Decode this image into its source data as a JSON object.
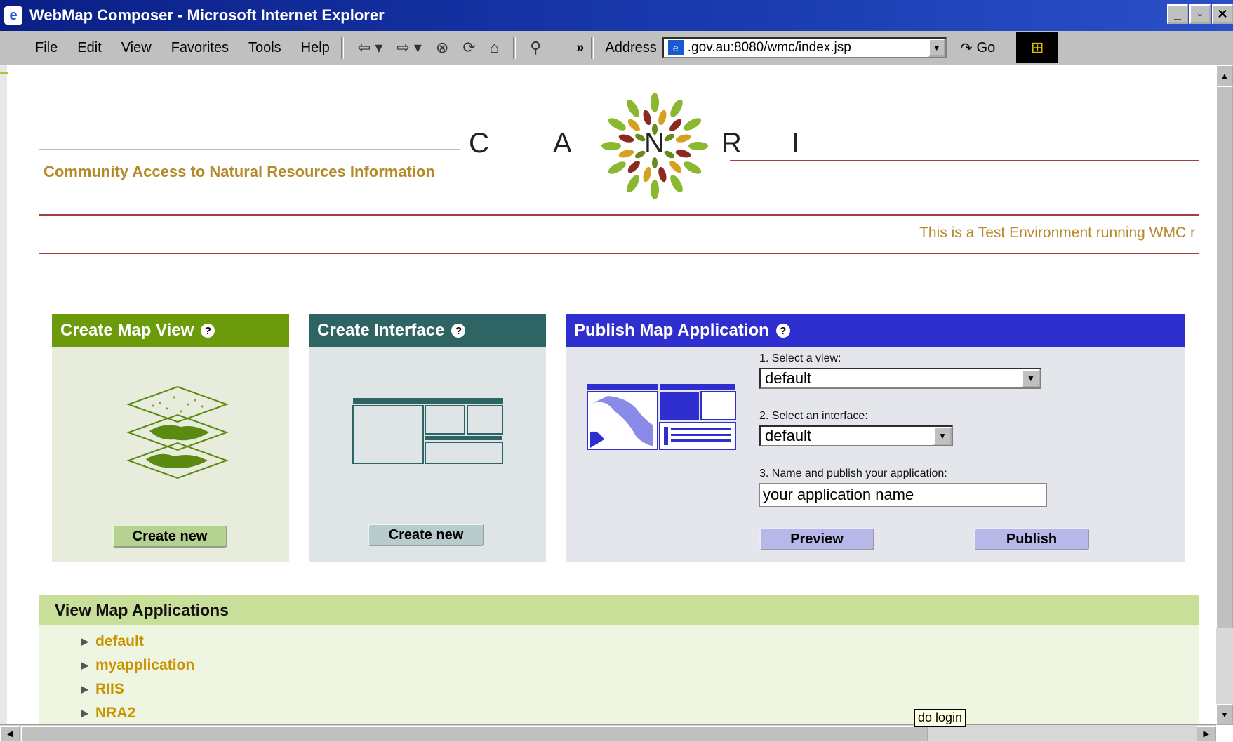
{
  "window": {
    "title": "WebMap Composer - Microsoft Internet Explorer",
    "controls": [
      "_",
      "▫",
      "✕"
    ]
  },
  "menubar": {
    "items": [
      "File",
      "Edit",
      "View",
      "Favorites",
      "Tools",
      "Help"
    ],
    "address_label": "Address",
    "address_value": ".gov.au:8080/wmc/index.jsp",
    "go_label": "Go",
    "chevron": "»"
  },
  "header": {
    "logo_letters": [
      "C",
      "A",
      "N",
      "R",
      "I"
    ],
    "tagline": "Community Access to Natural Resources Information",
    "test_notice": "This is a Test Environment running WMC r"
  },
  "panels": {
    "create_map_view": {
      "title": "Create Map View",
      "button": "Create new",
      "color": "#6b9a0a"
    },
    "create_interface": {
      "title": "Create Interface",
      "button": "Create new",
      "color": "#2f6464"
    },
    "publish": {
      "title": "Publish Map Application",
      "color": "#2f2fd0",
      "step1_label": "1. Select a view:",
      "step1_value": "default",
      "step2_label": "2. Select an interface:",
      "step2_value": "default",
      "step3_label": "3. Name and publish your application:",
      "name_value": "your application name",
      "preview_button": "Preview",
      "publish_button": "Publish"
    }
  },
  "apps": {
    "heading": "View Map Applications",
    "items": [
      "default",
      "myapplication",
      "RIIS",
      "NRA2"
    ]
  },
  "tooltip": "do login",
  "colors": {
    "link": "#c99200",
    "tagline": "#b58a2a",
    "apps_header_bg": "#c7df99",
    "apps_bg": "#eef5e0"
  }
}
